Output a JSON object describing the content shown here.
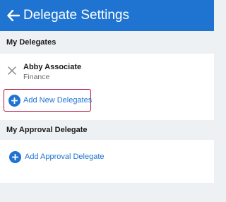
{
  "header": {
    "title": "Delegate Settings",
    "back_icon": "arrow-left-icon"
  },
  "my_delegates": {
    "section_title": "My Delegates",
    "delegates": [
      {
        "name": "Abby Associate",
        "department": "Finance",
        "remove_icon": "close-icon"
      }
    ],
    "add_button_label": "Add New Delegates"
  },
  "my_approval_delegate": {
    "section_title": "My Approval Delegate",
    "add_button_label": "Add Approval Delegate"
  },
  "colors": {
    "header_bg": "#1f74d1",
    "accent": "#1f74d1",
    "highlight_border": "#b0153d",
    "page_bg": "#eef1f4"
  }
}
